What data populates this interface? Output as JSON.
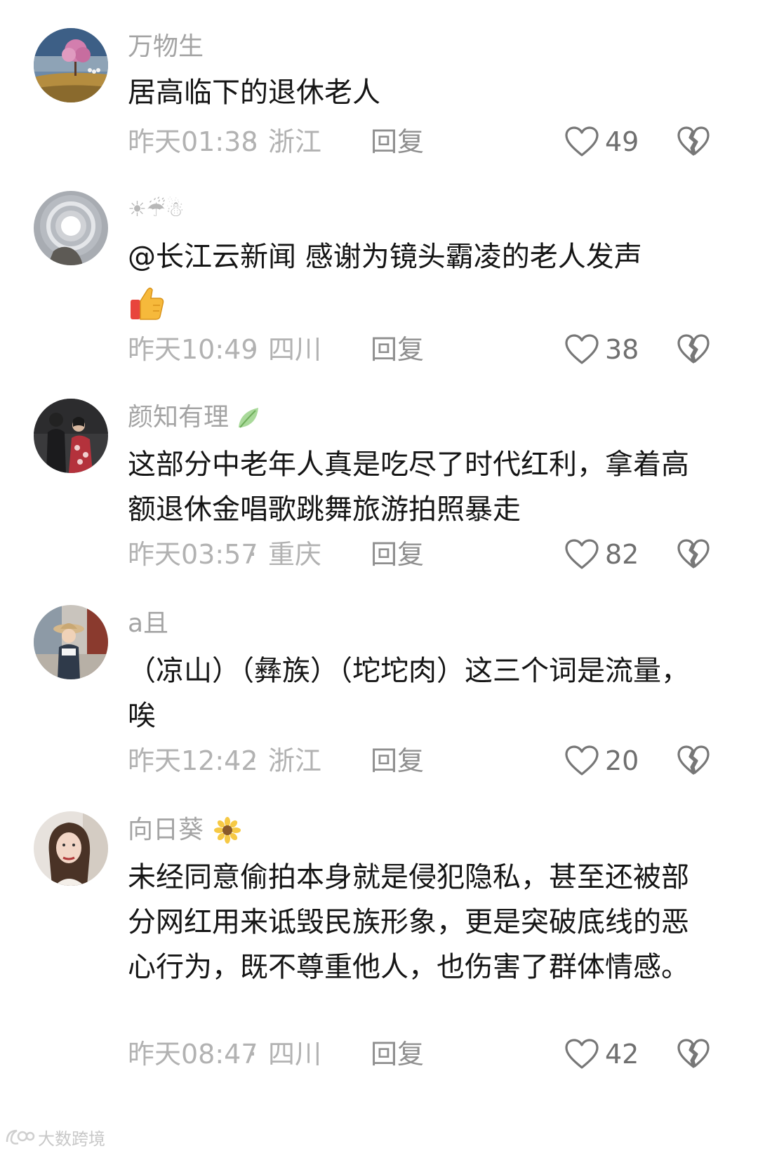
{
  "comments": [
    {
      "username": "万物生",
      "username_emoji": "",
      "text": "居高临下的退休老人",
      "time": "昨天01:38",
      "region": "浙江",
      "reply_label": "回复",
      "likes": "49",
      "avatar_icon": "landscape-tree-avatar"
    },
    {
      "username": "☀☔☃",
      "username_emoji": "",
      "text": "@长江云新闻 感谢为镜头霸凌的老人发声",
      "text_emoji": "thumbs-up-icon",
      "time": "昨天10:49",
      "region": "四川",
      "reply_label": "回复",
      "likes": "38",
      "avatar_icon": "sun-halo-avatar"
    },
    {
      "username": "颜知有理",
      "username_emoji": "leaf-icon",
      "text": "这部分中老年人真是吃尽了时代红利，拿着高额退休金唱歌跳舞旅游拍照暴走",
      "time": "昨天03:57",
      "region": "重庆",
      "reply_label": "回复",
      "likes": "82",
      "avatar_icon": "couple-photo-avatar"
    },
    {
      "username": "a且",
      "username_emoji": "",
      "text": "（凉山）（彝族）（坨坨肉）这三个词是流量，唉",
      "time": "昨天12:42",
      "region": "浙江",
      "reply_label": "回复",
      "likes": "20",
      "avatar_icon": "child-hat-avatar"
    },
    {
      "username": "向日葵",
      "username_emoji": "sunflower-icon",
      "text": "未经同意偷拍本身就是侵犯隐私，甚至还被部分网红用来诋毁民族形象，更是突破底线的恶心行为，既不尊重他人，也伤害了群体情感。",
      "time": "昨天08:47",
      "region": "四川",
      "reply_label": "回复",
      "likes": "42",
      "avatar_icon": "woman-portrait-avatar"
    }
  ],
  "separator": "·",
  "watermark": {
    "text": "大数跨境",
    "icon": "logo-icon"
  },
  "colors": {
    "meta_text": "#b2b2b2",
    "reply_text": "#8f8f8f",
    "body_text": "#151515",
    "username_text": "#a4a4a4",
    "icon_stroke": "#777777"
  }
}
